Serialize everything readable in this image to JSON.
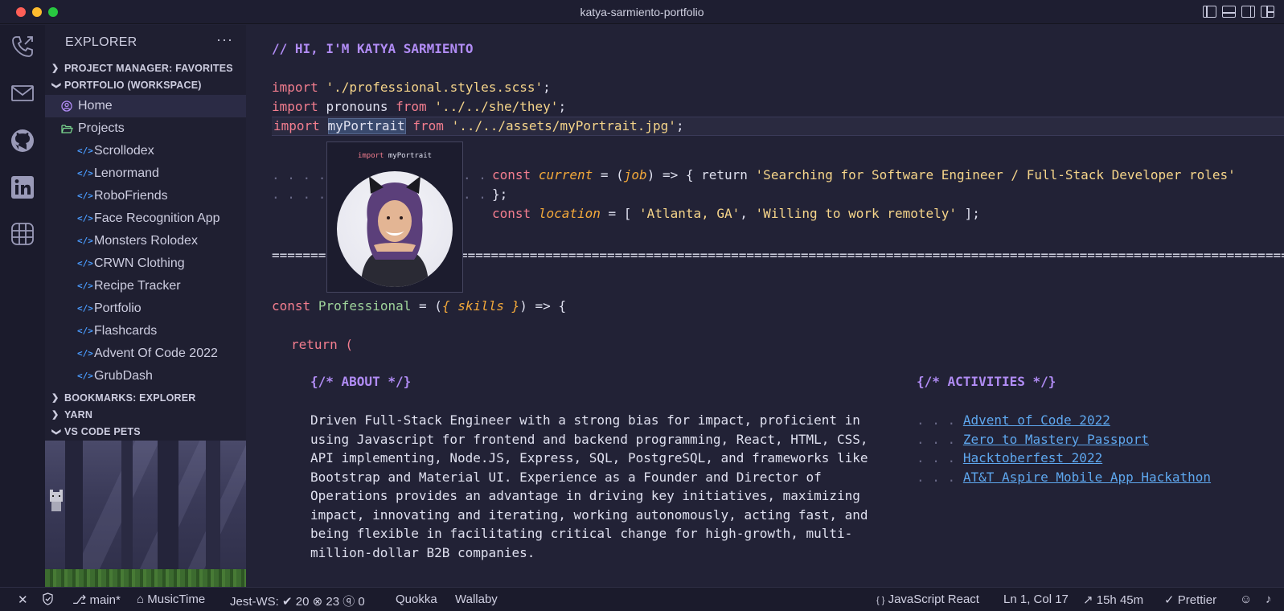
{
  "window": {
    "title": "katya-sarmiento-portfolio"
  },
  "activity_bar": {
    "icons": [
      "phone-icon",
      "mail-icon",
      "github-icon",
      "linkedin-icon",
      "grid-icon"
    ]
  },
  "sidebar": {
    "title": "EXPLORER",
    "more": "···",
    "sections": {
      "project_manager": "PROJECT MANAGER: FAVORITES",
      "workspace": "PORTFOLIO (WORKSPACE)",
      "bookmarks": "BOOKMARKS: EXPLORER",
      "yarn": "YARN",
      "pets": "VS CODE PETS"
    },
    "home": "Home",
    "projects": "Projects",
    "project_items": [
      "Scrollodex",
      "Lenormand",
      "RoboFriends",
      "Face Recognition App",
      "Monsters Rolodex",
      "CRWN Clothing",
      "Recipe Tracker",
      "Portfolio",
      "Flashcards",
      "Advent Of Code 2022",
      "GrubDash"
    ]
  },
  "editor": {
    "heading": "// HI, I'M KATYA SARMIENTO",
    "import1": {
      "kw": "import",
      "path": "'./professional.styles.scss'",
      "end": ";"
    },
    "import2": {
      "kw": "import",
      "name": "pronouns",
      "from": "from",
      "path": "'../../she/they'",
      "end": ";"
    },
    "import3": {
      "kw": "import",
      "name": "myPortrait",
      "from": "from",
      "path": "'../../assets/myPortrait.jpg'",
      "end": ";"
    },
    "hover": {
      "kw": "import",
      "name": "myPortrait"
    },
    "current": {
      "const": "const",
      "name": "current",
      "eq": " = (",
      "param": "job",
      "arrow": ") => { return ",
      "value": "'Searching for Software Engineer / Full-Stack Developer roles'"
    },
    "close_brace": "};",
    "location": {
      "const": "const",
      "name": "location",
      "eq": " = [ ",
      "v1": "'Atlanta, GA'",
      "comma": ", ",
      "v2": "'Willing to work remotely'",
      "end": " ];"
    },
    "separator": "=======",
    "separator_long": "===============================================================================================================",
    "professional": {
      "const": "const",
      "name": "Professional",
      "eq": " = (",
      "open": "{",
      "param": " skills ",
      "close": "}",
      "arrow": ") => {"
    },
    "return": "return (",
    "about_heading": "{/* ABOUT */}",
    "about_lines": [
      "Driven Full-Stack Engineer with a strong bias for impact, proficient in",
      "using Javascript for frontend and backend programming, React, HTML, CSS,",
      "API implementing, Node.JS, Express, SQL, PostgreSQL, and frameworks like",
      "Bootstrap and Material UI. Experience as a Founder and Director of",
      "Operations provides an advantage in driving key initiatives, maximizing",
      "impact, innovating and iterating, working autonomously, acting fast, and",
      "being flexible in facilitating critical change for high-growth, multi-",
      "million-dollar B2B companies."
    ],
    "activities_heading": "{/* ACTIVITIES */}",
    "activities": [
      "Advent of Code 2022",
      "Zero to Mastery Passport",
      "Hacktoberfest 2022",
      "AT&T Aspire Mobile App Hackathon"
    ],
    "dots": ". . .",
    "indent_dots": ". . . ."
  },
  "statusbar": {
    "branch": "main*",
    "musictime": "MusicTime",
    "jest": "Jest-WS:",
    "passed": "20",
    "failed": "23",
    "unknown": "0",
    "quokka": "Quokka",
    "wallaby": "Wallaby",
    "language": "JavaScript React",
    "position": "Ln 1, Col 17",
    "time": "15h 45m",
    "prettier": "Prettier"
  }
}
